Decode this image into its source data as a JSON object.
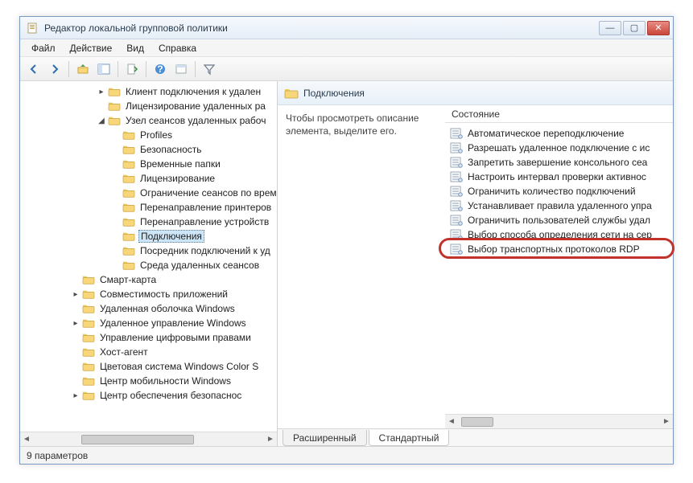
{
  "title": "Редактор локальной групповой политики",
  "menu": {
    "file": "Файл",
    "action": "Действие",
    "view": "Вид",
    "help": "Справка"
  },
  "tree": [
    {
      "indent": 95,
      "exp": "▸",
      "label": "Клиент подключения к удален"
    },
    {
      "indent": 95,
      "exp": "",
      "label": "Лицензирование удаленных ра"
    },
    {
      "indent": 95,
      "exp": "◢",
      "label": "Узел сеансов удаленных рабоч"
    },
    {
      "indent": 113,
      "exp": "",
      "label": "Profiles"
    },
    {
      "indent": 113,
      "exp": "",
      "label": "Безопасность"
    },
    {
      "indent": 113,
      "exp": "",
      "label": "Временные папки"
    },
    {
      "indent": 113,
      "exp": "",
      "label": "Лицензирование"
    },
    {
      "indent": 113,
      "exp": "",
      "label": "Ограничение сеансов по врем"
    },
    {
      "indent": 113,
      "exp": "",
      "label": "Перенаправление принтеров"
    },
    {
      "indent": 113,
      "exp": "",
      "label": "Перенаправление устройств"
    },
    {
      "indent": 113,
      "exp": "",
      "label": "Подключения",
      "selected": true
    },
    {
      "indent": 113,
      "exp": "",
      "label": "Посредник подключений к уд"
    },
    {
      "indent": 113,
      "exp": "",
      "label": "Среда удаленных сеансов"
    },
    {
      "indent": 63,
      "exp": "",
      "label": "Смарт-карта"
    },
    {
      "indent": 63,
      "exp": "▸",
      "label": "Совместимость приложений"
    },
    {
      "indent": 63,
      "exp": "",
      "label": "Удаленная оболочка Windows"
    },
    {
      "indent": 63,
      "exp": "▸",
      "label": "Удаленное управление Windows"
    },
    {
      "indent": 63,
      "exp": "",
      "label": "Управление цифровыми правами"
    },
    {
      "indent": 63,
      "exp": "",
      "label": "Хост-агент"
    },
    {
      "indent": 63,
      "exp": "",
      "label": "Цветовая система Windows Color S"
    },
    {
      "indent": 63,
      "exp": "",
      "label": "Центр мобильности Windows"
    },
    {
      "indent": 63,
      "exp": "▸",
      "label": "Центр обеспечения безопаснос"
    }
  ],
  "detail": {
    "header": "Подключения",
    "description": "Чтобы просмотреть описание элемента, выделите его.",
    "column": "Состояние",
    "items": [
      "Автоматическое переподключение",
      "Разрешать удаленное подключение с ис",
      "Запретить завершение консольного сеа",
      "Настроить интервал проверки активнос",
      "Ограничить количество подключений",
      "Устанавливает правила удаленного упра",
      "Ограничить пользователей службы удал",
      "Выбор способа определения сети на сер",
      "Выбор транспортных протоколов RDP"
    ],
    "highlighted_index": 8
  },
  "tabs": {
    "extended": "Расширенный",
    "standard": "Стандартный"
  },
  "status": "9 параметров"
}
